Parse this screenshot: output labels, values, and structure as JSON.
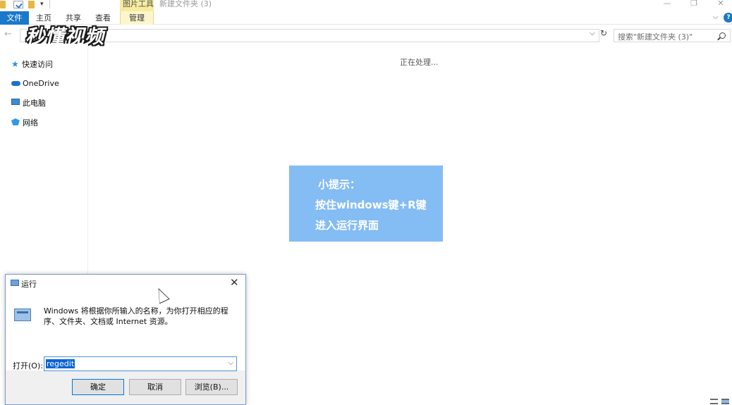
{
  "titlebar": {
    "context_tool": "图片工具",
    "window_title": "新建文件夹 (3)"
  },
  "ribbon": {
    "tabs": [
      "文件",
      "主页",
      "共享",
      "查看",
      "管理"
    ]
  },
  "address": {
    "search_placeholder": "搜索\"新建文件夹 (3)\""
  },
  "watermark": "秒懂视频",
  "nav_pane": {
    "items": [
      {
        "label": "快速访问",
        "icon": "star-icon"
      },
      {
        "label": "OneDrive",
        "icon": "cloud-icon"
      },
      {
        "label": "此电脑",
        "icon": "computer-icon"
      },
      {
        "label": "网络",
        "icon": "network-icon"
      }
    ]
  },
  "content": {
    "status": "正在处理...",
    "tip": {
      "line1": "小提示：",
      "line2": "按住windows键+R键",
      "line3": "进入运行界面"
    }
  },
  "run_dialog": {
    "title": "运行",
    "description": "Windows 将根据你所输入的名称，为你打开相应的程序、文件夹、文档或 Internet 资源。",
    "open_label": "打开(O):",
    "open_value": "regedit",
    "buttons": {
      "ok": "确定",
      "cancel": "取消",
      "browse": "浏览(B)..."
    }
  },
  "colors": {
    "accent": "#1979ca",
    "tip_background": "#84bcf4",
    "context_tab": "#f7ec9c"
  }
}
